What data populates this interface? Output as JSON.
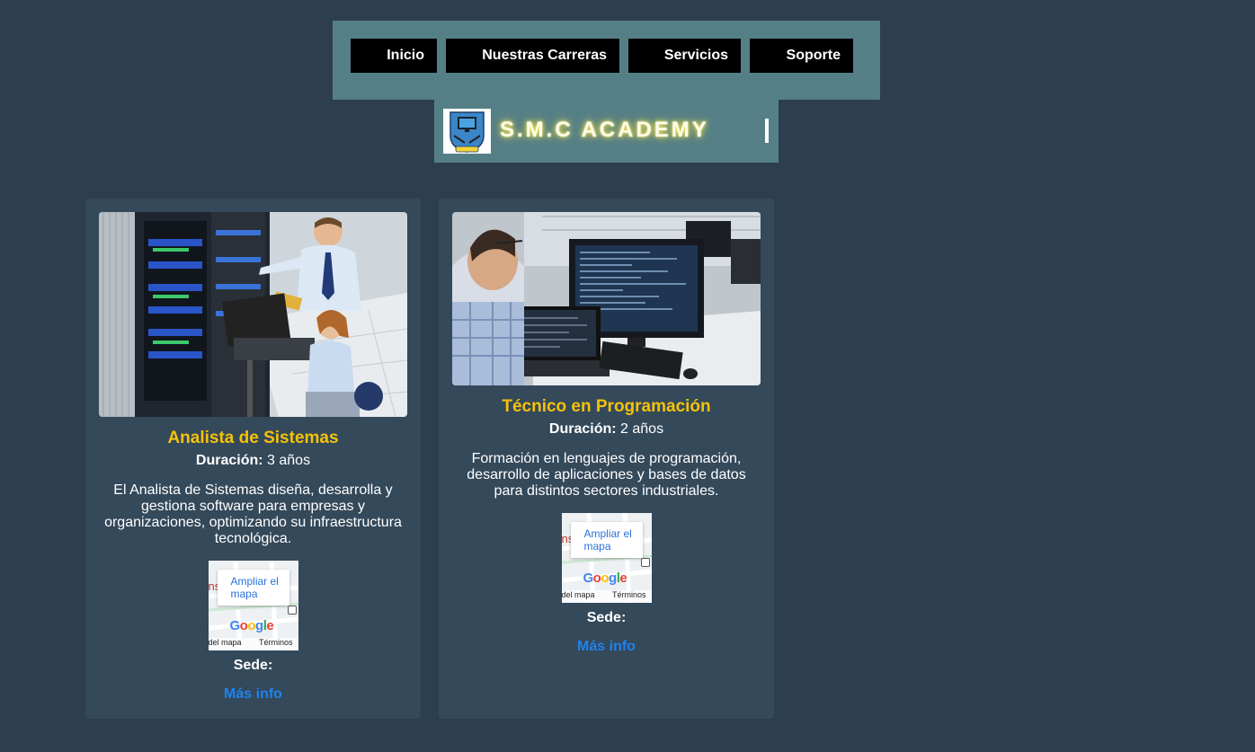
{
  "nav": {
    "items": [
      {
        "label": "Inicio"
      },
      {
        "label": "Nuestras Carreras"
      },
      {
        "label": "Servicios"
      },
      {
        "label": "Soporte"
      }
    ]
  },
  "brand": {
    "title": "S.M.C ACADEMY"
  },
  "cards": [
    {
      "title": "Analista de Sistemas",
      "duration_label": "Duración:",
      "duration_value": "3 años",
      "description": "El Analista de Sistemas diseña, desarrolla y gestiona software para empresas y organizaciones, optimizando su infraestructura tecnológica.",
      "map": {
        "link": "Ampliar el mapa",
        "google": "Google",
        "left_text": "del mapa",
        "terms": "Términos",
        "partial": "ns Fl"
      },
      "sede_label": "Sede:",
      "more": "Más info"
    },
    {
      "title": "Técnico en Programación",
      "duration_label": "Duración:",
      "duration_value": "2 años",
      "description": "Formación en lenguajes de programación, desarrollo de aplicaciones y bases de datos para distintos sectores industriales.",
      "map": {
        "link": "Ampliar el mapa",
        "google": "Google",
        "left_text": "del mapa",
        "terms": "Términos",
        "partial": "ns Fl"
      },
      "sede_label": "Sede:",
      "more": "Más info"
    }
  ],
  "colors": {
    "background": "#2d3e50",
    "nav_panel": "#557f87",
    "card": "#34495a",
    "title": "#f5c20a",
    "link": "#1e83f0"
  }
}
